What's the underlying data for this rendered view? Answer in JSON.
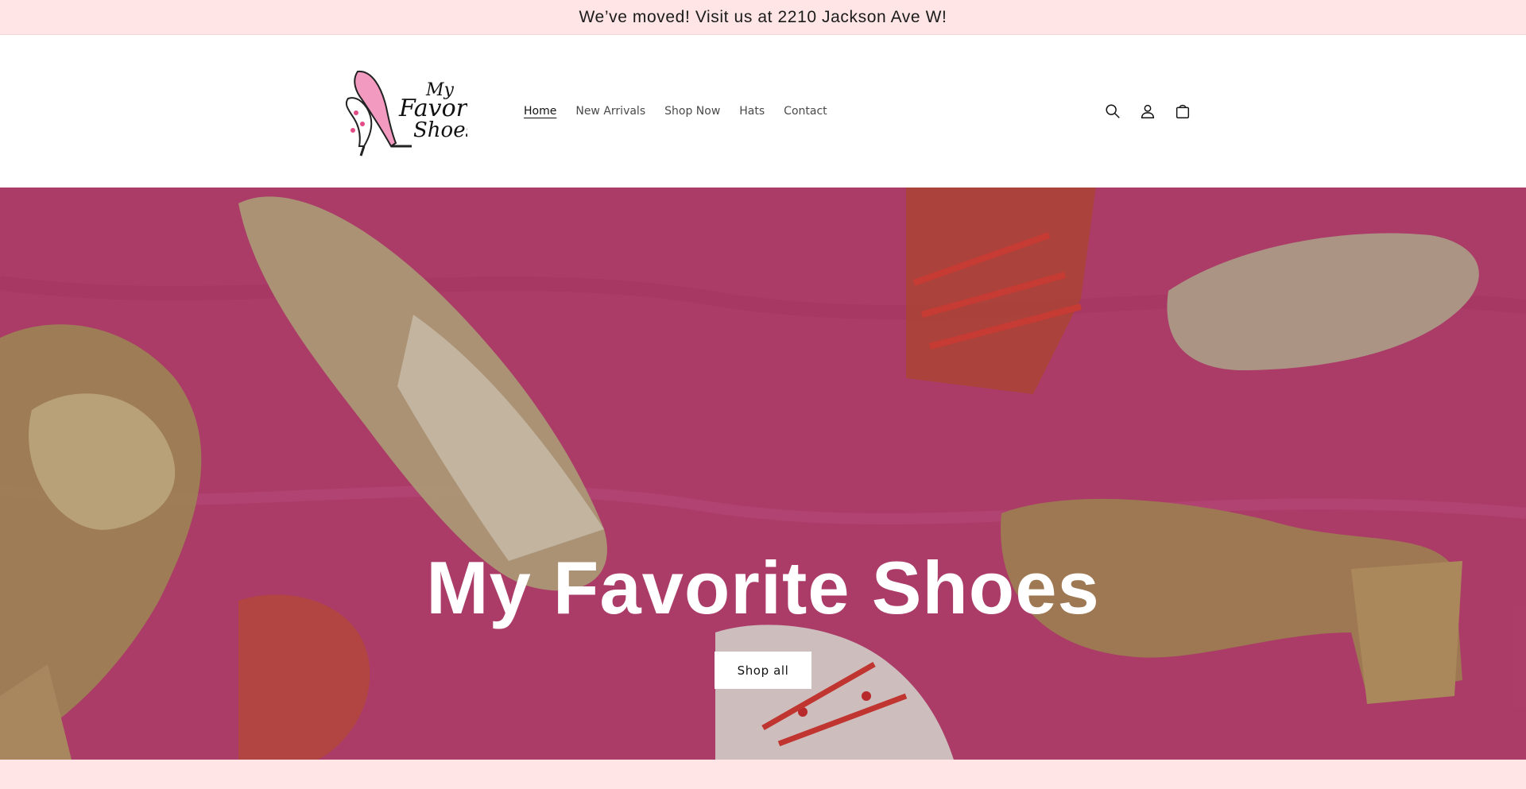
{
  "announcement": {
    "text": "We’ve moved! Visit us at 2210 Jackson Ave W!"
  },
  "header": {
    "logo": {
      "text_line1": "My",
      "text_line2": "Favorite",
      "text_line3": "Shoes"
    },
    "nav": [
      {
        "label": "Home",
        "active": true
      },
      {
        "label": "New Arrivals"
      },
      {
        "label": "Shop Now"
      },
      {
        "label": "Hats"
      },
      {
        "label": "Contact"
      }
    ],
    "icons": [
      "search-icon",
      "account-icon",
      "cart-icon"
    ]
  },
  "hero": {
    "title": "My Favorite Shoes",
    "button_label": "Shop all",
    "background_color": "#c9477a"
  },
  "colors": {
    "announcement_bg": "#ffe5e5",
    "header_bg": "#ffffff",
    "hero_bg": "#c9477a",
    "text": "#121212"
  }
}
